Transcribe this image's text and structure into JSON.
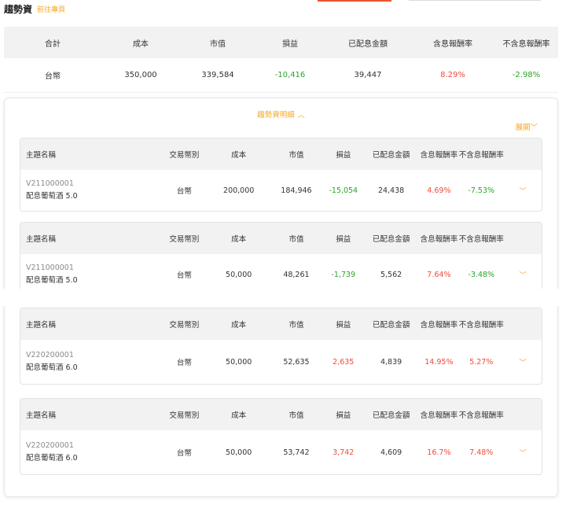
{
  "page": {
    "title": "趨勢資",
    "goto_link": "前往專頁"
  },
  "summary": {
    "headers": [
      "合計",
      "成本",
      "市值",
      "損益",
      "已配息金額",
      "含息報酬率",
      "不含息報酬率"
    ],
    "row": {
      "label": "台幣",
      "cost": "350,000",
      "market_value": "339,584",
      "profit_loss": "-10,416",
      "dividend": "39,447",
      "return_with_dividend": "8.29%",
      "return_without_dividend": "-2.98%"
    }
  },
  "detail": {
    "title": "趨勢資明細",
    "expand_label": "展開",
    "headers": {
      "name": "主題名稱",
      "currency": "交易幣別",
      "cost": "成本",
      "market_value": "市值",
      "profit_loss": "損益",
      "dividend": "已配息金額",
      "return_with_dividend": "含息報酬率",
      "return_without_dividend": "不含息報酬率"
    },
    "items": [
      {
        "code": "V211000001",
        "name": "配息葡萄酒 5.0",
        "currency": "台幣",
        "cost": "200,000",
        "market_value": "184,946",
        "profit_loss": "-15,054",
        "dividend": "24,438",
        "return_with_dividend": "4.69%",
        "return_without_dividend": "-7.53%"
      },
      {
        "code": "V211000001",
        "name": "配息葡萄酒 5.0",
        "currency": "台幣",
        "cost": "50,000",
        "market_value": "48,261",
        "profit_loss": "-1,739",
        "dividend": "5,562",
        "return_with_dividend": "7.64%",
        "return_without_dividend": "-3.48%"
      },
      {
        "code": "V220200001",
        "name": "配息葡萄酒 6.0",
        "currency": "台幣",
        "cost": "50,000",
        "market_value": "52,635",
        "profit_loss": "2,635",
        "dividend": "4,839",
        "return_with_dividend": "14.95%",
        "return_without_dividend": "5.27%"
      },
      {
        "code": "V220200001",
        "name": "配息葡萄酒 6.0",
        "currency": "台幣",
        "cost": "50,000",
        "market_value": "53,742",
        "profit_loss": "3,742",
        "dividend": "4,609",
        "return_with_dividend": "16.7%",
        "return_without_dividend": "7.48%"
      }
    ]
  },
  "colors": {
    "accent": "#f5a623",
    "positive": "#f04b3a",
    "negative": "#2aa52a",
    "tab_underline": "#e8542f"
  },
  "icons": {
    "collapse": "chevron-up-icon",
    "expand": "chevron-down-icon"
  }
}
